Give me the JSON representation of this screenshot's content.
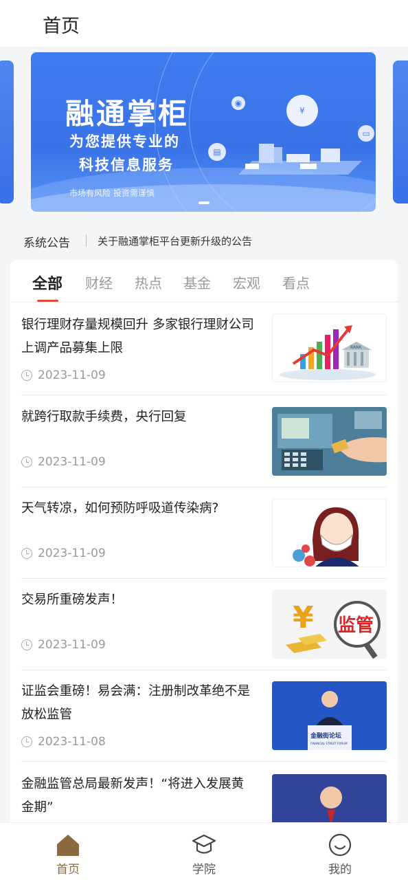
{
  "header": {
    "title": "首页"
  },
  "banner": {
    "title": "融通掌柜",
    "subtitle_line1": "为您提供专业的",
    "subtitle_line2": "科技信息服务",
    "risk_note": "市场有风险 投资需谨慎"
  },
  "notice": {
    "label": "系统公告",
    "text": "关于融通掌柜平台更新升级的公告"
  },
  "tabs": [
    {
      "label": "全部",
      "active": true
    },
    {
      "label": "财经"
    },
    {
      "label": "热点"
    },
    {
      "label": "基金"
    },
    {
      "label": "宏观"
    },
    {
      "label": "看点"
    }
  ],
  "news": [
    {
      "title": "银行理财存量规模回升 多家银行理财公司上调产品募集上限",
      "date": "2023-11-09",
      "thumb": "bank-chart-image"
    },
    {
      "title": "就跨行取款手续费，央行回复",
      "date": "2023-11-09",
      "thumb": "atm-image"
    },
    {
      "title": "天气转凉，如何预防呼吸道传染病?",
      "date": "2023-11-09",
      "thumb": "mask-illustration"
    },
    {
      "title": "交易所重磅发声！",
      "date": "2023-11-09",
      "thumb": "regulation-image"
    },
    {
      "title": "证监会重磅！易会满：注册制改革绝不是放松监管",
      "date": "2023-11-08",
      "thumb": "forum-speaker-image"
    },
    {
      "title": "金融监管总局最新发声！“将进入发展黄金期”",
      "date": "",
      "thumb": "speaker-image"
    }
  ],
  "thumb_text": {
    "bank": "BANK",
    "regulation": "监管",
    "forum_cn": "金融街论坛",
    "forum_en": "FINANCIAL STREET FORUM"
  },
  "bottom_nav": [
    {
      "label": "首页",
      "icon": "home-icon",
      "active": true
    },
    {
      "label": "学院",
      "icon": "graduation-cap-icon"
    },
    {
      "label": "我的",
      "icon": "smile-icon"
    }
  ],
  "colors": {
    "banner_blue": "#3f7cf0",
    "tab_underline": "#e04b3a",
    "nav_active": "#8a6a3e"
  }
}
